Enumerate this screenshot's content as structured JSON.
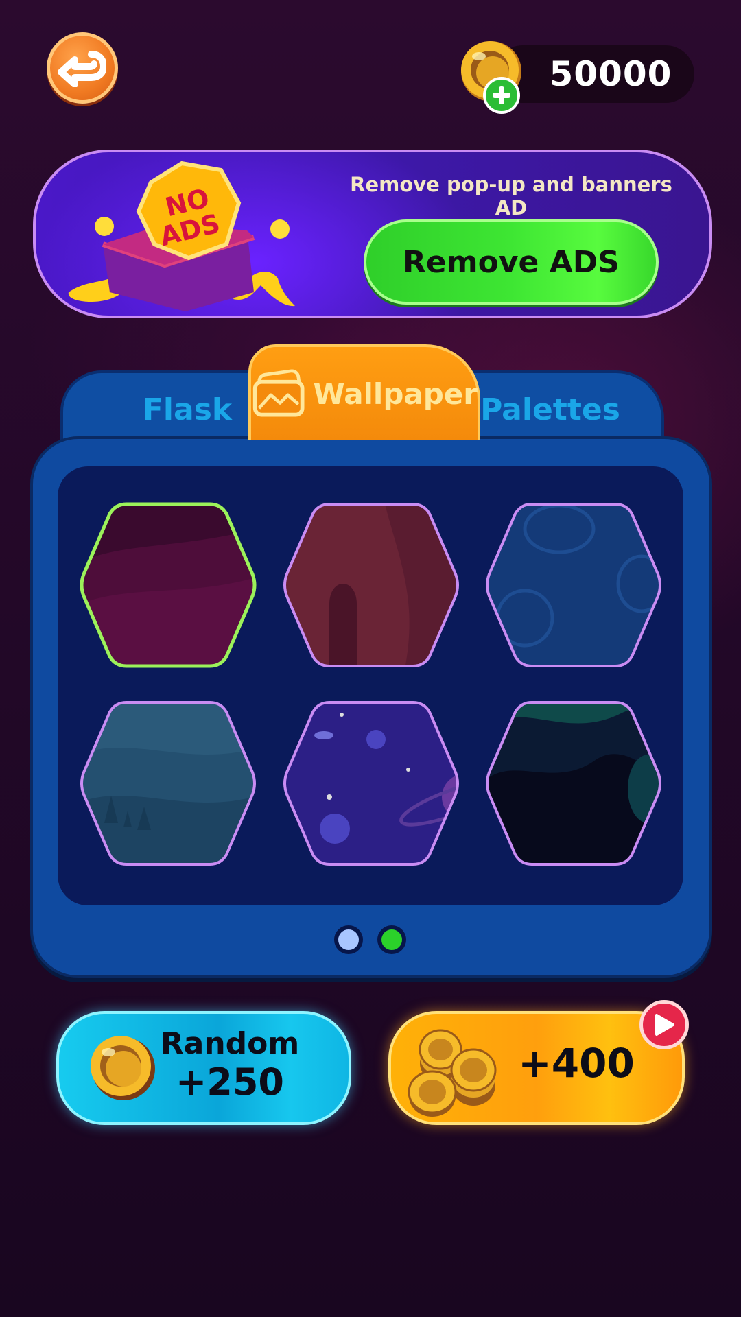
{
  "header": {
    "coins": "50000"
  },
  "ads_banner": {
    "description": "Remove pop-up and banners AD",
    "button_label": "Remove ADS",
    "badge_line1": "NO",
    "badge_line2": "ADS"
  },
  "tabs": [
    {
      "label": "Flask",
      "active": false
    },
    {
      "label": "Wallpaper",
      "active": true
    },
    {
      "label": "Palettes",
      "active": false
    }
  ],
  "wallpapers": [
    {
      "name": "crimson-waves",
      "selected": true,
      "colors": [
        "#4a0d36",
        "#2a0726"
      ]
    },
    {
      "name": "red-canyon",
      "selected": false,
      "colors": [
        "#6b2436",
        "#4a1830"
      ]
    },
    {
      "name": "blue-doodles",
      "selected": false,
      "colors": [
        "#153e7a",
        "#103266"
      ]
    },
    {
      "name": "misty-hills",
      "selected": false,
      "colors": [
        "#2a5a7a",
        "#1c3f5c"
      ]
    },
    {
      "name": "space",
      "selected": false,
      "colors": [
        "#3b2a9a",
        "#231a6a"
      ]
    },
    {
      "name": "aurora",
      "selected": false,
      "colors": [
        "#0f2b3f",
        "#070d22"
      ]
    }
  ],
  "pagination": {
    "current_page": 2,
    "total_pages": 2
  },
  "bottom_buttons": {
    "random_label": "Random",
    "random_value": "+250",
    "reward_value": "+400"
  },
  "colors": {
    "accent_green": "#3ee633",
    "accent_orange": "#f48a0b",
    "panel_blue": "#0f4aa0",
    "selected_outline": "#9cf25a",
    "hex_outline": "#c98cf3"
  },
  "icons": [
    "back-arrow-icon",
    "coin-icon",
    "plus-icon",
    "wallpaper-icon",
    "coin-stack-icon",
    "video-play-icon"
  ]
}
